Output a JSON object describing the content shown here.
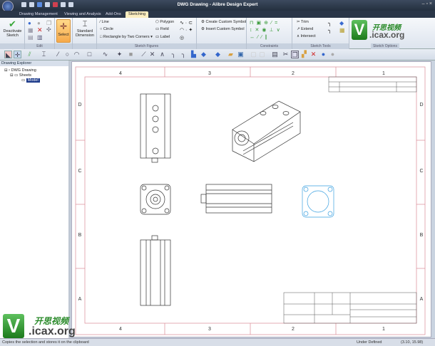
{
  "window": {
    "title": "DWG Drawing - Alibre Design Expert"
  },
  "tabs": [
    {
      "label": "Drawing Management"
    },
    {
      "label": "Viewing and Analysis"
    },
    {
      "label": "Add-Ons"
    },
    {
      "label": "Sketching",
      "active": true
    }
  ],
  "ribbon": {
    "deactivate": "Deactivate Sketch",
    "select": "Select",
    "standard_dimension": "Standard Dimension",
    "line": "Line",
    "circle": "Circle",
    "rectangle": "Rectangle by Two Corners",
    "polygon": "Polygon",
    "field": "Field",
    "label": "Label",
    "create_symbol": "Create Custom Symbol",
    "insert_symbol": "Insert Custom Symbol",
    "trim": "Trim",
    "extend": "Extend",
    "intersect": "Intersect",
    "groups": {
      "edit": "Edit",
      "sketch_figures": "Sketch Figures",
      "constraints": "Constraints",
      "sketch_tools": "Sketch Tools",
      "sketch_options": "Sketch Options"
    }
  },
  "explorer": {
    "title": "Drawing Explorer",
    "root": "DWG Drawing",
    "sheets": "Sheets",
    "model": "Model"
  },
  "sheet": {
    "columns": [
      "4",
      "3",
      "2",
      "1"
    ],
    "rows": [
      "D",
      "C",
      "B",
      "A"
    ]
  },
  "status": {
    "message": "Copies the selection and stores it on the clipboard",
    "state": "Under Defined",
    "coords": "(3.10, 15.98)"
  },
  "watermark": {
    "letter": "V",
    "cn": "开思视频",
    "site": ".icax.org"
  },
  "colors": {
    "accent": "#f6a94a",
    "sheet_border": "#d98a95",
    "selected_view": "#3aa0e0"
  }
}
